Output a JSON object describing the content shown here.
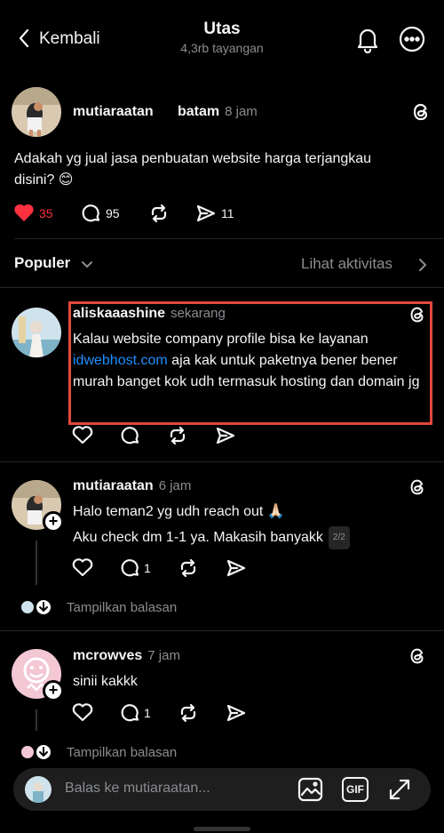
{
  "header": {
    "back_label": "Kembali",
    "title": "Utas",
    "subtitle": "4,3rb tayangan",
    "icons": [
      "chevron-left-icon",
      "bell-icon",
      "more-icon"
    ]
  },
  "post": {
    "username": "mutiaraatan",
    "topic": "batam",
    "time": "8 jam",
    "text": "Adakah yg jual jasa penbuatan website harga terjangkau disini? 😊",
    "likes": "35",
    "comments": "95",
    "shares": "11",
    "liked": true,
    "like_color": "#ff3040"
  },
  "sort": {
    "label": "Populer",
    "activity_link": "Lihat aktivitas"
  },
  "replies": [
    {
      "username": "aliskaaashine",
      "time": "sekarang",
      "text_before_link": "Kalau website company profile bisa ke layanan ",
      "link": "idwebhost.com",
      "text_after_link": " aja kak untuk paketnya bener bener murah banget kok udh termasuk hosting dan domain jg",
      "highlight_color": "#e2483d"
    },
    {
      "username": "mutiaraatan",
      "time": "6 jam",
      "line1": "Halo teman2 yg udh reach out 🙏🏻",
      "line2": "Aku check dm 1-1 ya. Makasih banyakk",
      "pager": "2/2",
      "comments": "1",
      "show_replies": "Tampilkan balasan"
    },
    {
      "username": "mcrowves",
      "time": "7 jam",
      "text": "sinii kakkk",
      "comments": "1",
      "show_replies": "Tampilkan balasan"
    }
  ],
  "reply_bar": {
    "placeholder": "Balas ke mutiaraatan...",
    "icons": [
      "image-icon",
      "gif-icon",
      "expand-icon"
    ],
    "gif_label": "GIF"
  },
  "colors": {
    "background": "#000000",
    "text": "#f3f5f7",
    "muted": "#8a8d91",
    "link": "#1e90ff"
  }
}
